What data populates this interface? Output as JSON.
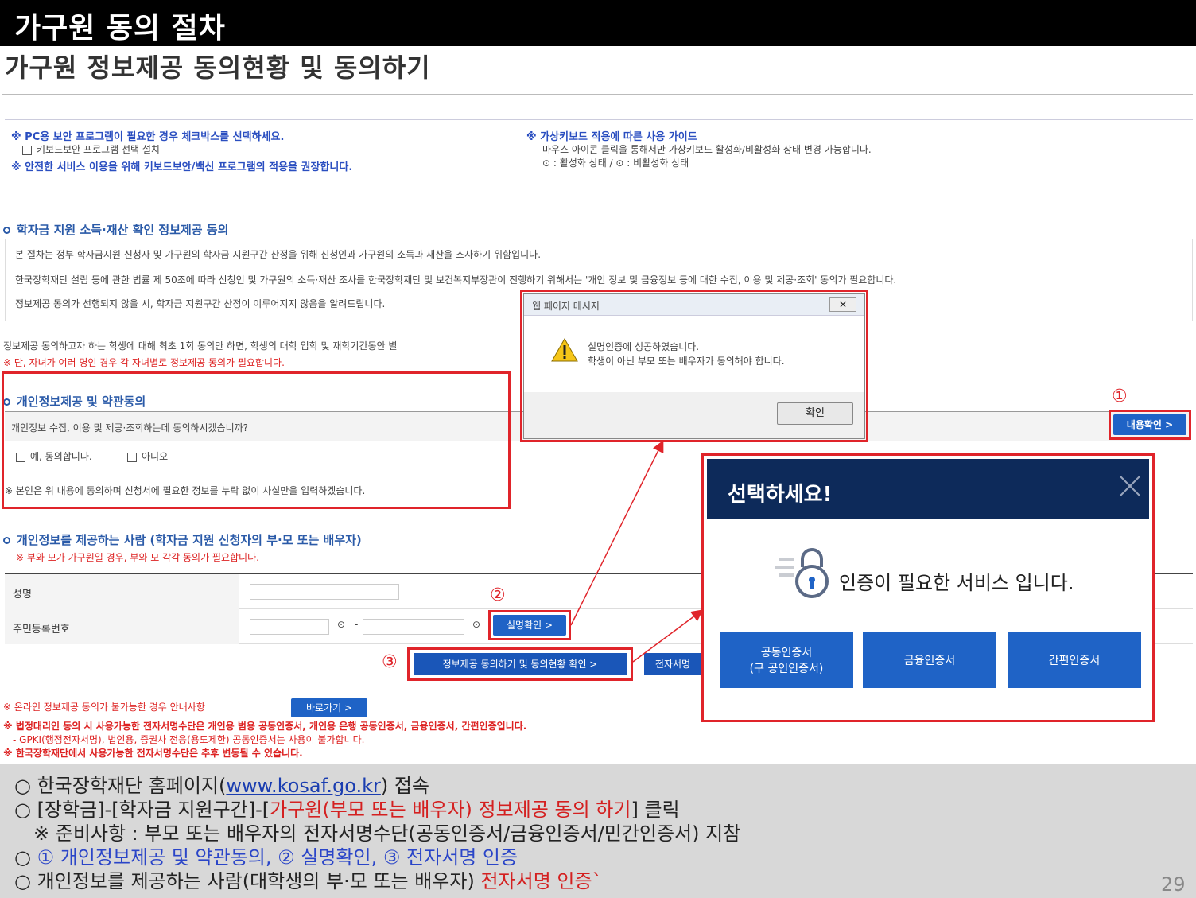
{
  "header": {
    "title": "가구원 동의 절차",
    "subtitle": "가구원 정보제공 동의현황 및 동의하기"
  },
  "security": {
    "notice1": "※ PC용 보안 프로그램이 필요한 경우 체크박스를 선택하세요.",
    "checkbox_label": "키보드보안 프로그램 선택 설치",
    "notice2": "※ 안전한 서비스 이용을 위해 키보드보안/백신 프로그램의 적용을 권장합니다.",
    "vk_title": "※ 가상키보드 적용에 따른 사용 가이드",
    "vk_desc": "마우스 아이콘 클릭을 통해서만 가상키보드 활성화/비활성화 상태 변경 가능합니다.",
    "vk_status": "⊙ : 활성화 상태 / ⊙ : 비활성화 상태"
  },
  "section1": {
    "heading": "학자금 지원 소득·재산 확인 정보제공 동의",
    "p1": "본 절차는 정부 학자금지원 신청자 및 가구원의 학자금 지원구간 산정을 위해 신청인과 가구원의 소득과 재산을 조사하기 위함입니다.",
    "p2": "한국장학재단 설립 등에 관한 법률 제 50조에 따라 신청인 및 가구원의 소득·재산 조사를 한국장학재단 및 보건복지부장관이 진행하기 위해서는 '개인 정보 및 금융정보 등에 대한 수집, 이용 및 제공·조회' 동의가 필요합니다.",
    "p3": "정보제공 동의가 선행되지 않을 시, 학자금 지원구간 산정이 이루어지지 않음을 알려드립니다.",
    "note1": "정보제공 동의하고자 하는 학생에 대해 최초 1회 동의만 하면, 학생의 대학 입학 및 재학기간동안 별",
    "note2": "※ 단, 자녀가 여러 명인 경우 각 자녀별로 정보제공 동의가 필요합니다."
  },
  "consent": {
    "heading": "개인정보제공 및 약관동의",
    "question": "개인정보 수집, 이용 및 제공·조회하는데 동의하시겠습니까?",
    "yes": "예, 동의합니다.",
    "no": "아니오",
    "pledge": "※ 본인은 위 내용에 동의하며 신청서에 필요한 정보를 누락 없이 사실만을 입력하겠습니다.",
    "view_button": "내용확인 >"
  },
  "provider": {
    "heading": "개인정보를 제공하는 사람 (학자금 지원 신청자의 부·모 또는 배우자)",
    "note": "※ 부와 모가 가구원일 경우, 부와 모 각각 동의가 필요합니다.",
    "name_label": "성명",
    "rrn_label": "주민등록번호",
    "rrn_dash": "-",
    "verify_button": "실명확인 >",
    "submit_button": "정보제공 동의하기 및 동의현황 확인 >",
    "esign_button": "전자서명"
  },
  "bottom_notes": {
    "offline": "※ 온라인 정보제공 동의가 불가능한 경우 안내사항",
    "goto_button": "바로가기 >",
    "legal1": "※ 법정대리인 동의 시 사용가능한 전자서명수단은 개인용 범용 공동인증서, 개인용 은행 공동인증서, 금융인증서, 간편인증입니다.",
    "legal2": "- GPKI(행정전자서명), 법인용, 증권사 전용(용도제한) 공동인증서는 사용이 불가합니다.",
    "legal3": "※ 한국장학재단에서 사용가능한 전자서명수단은 추후 변동될 수 있습니다."
  },
  "markers": {
    "m1": "①",
    "m2": "②",
    "m3": "③"
  },
  "msg_dialog": {
    "title": "웹 페이지 메시지",
    "line1": "실명인증에 성공하였습니다.",
    "line2": "학생이 아닌 부모 또는 배우자가 동의해야 합니다.",
    "ok": "확인"
  },
  "auth_modal": {
    "title": "선택하세요!",
    "message": "인증이 필요한 서비스 입니다.",
    "btn1_line1": "공동인증서",
    "btn1_line2": "(구 공인인증서)",
    "btn2": "금융인증서",
    "btn3": "간편인증서"
  },
  "instructions": {
    "l1_pre": "○ 한국장학재단 홈페이지(",
    "l1_link": "www.kosaf.go.kr",
    "l1_post": ") 접속",
    "l2_pre": "○ [장학금]-[학자금 지원구간]-[",
    "l2_red": "가구원(부모 또는 배우자) 정보제공 동의 하기",
    "l2_post": "] 클릭",
    "l3": "※ 준비사항 : 부모 또는 배우자의 전자서명수단(공동인증서/금융인증서/민간인증서) 지참",
    "l4_pre": "○ ",
    "l4_blue": "① 개인정보제공 및 약관동의, ② 실명확인, ③ 전자서명 인증",
    "l5_pre": "○ 개인정보를 제공하는 사람(대학생의 부·모 또는 배우자) ",
    "l5_red": "전자서명 인증`"
  },
  "page_number": "29"
}
